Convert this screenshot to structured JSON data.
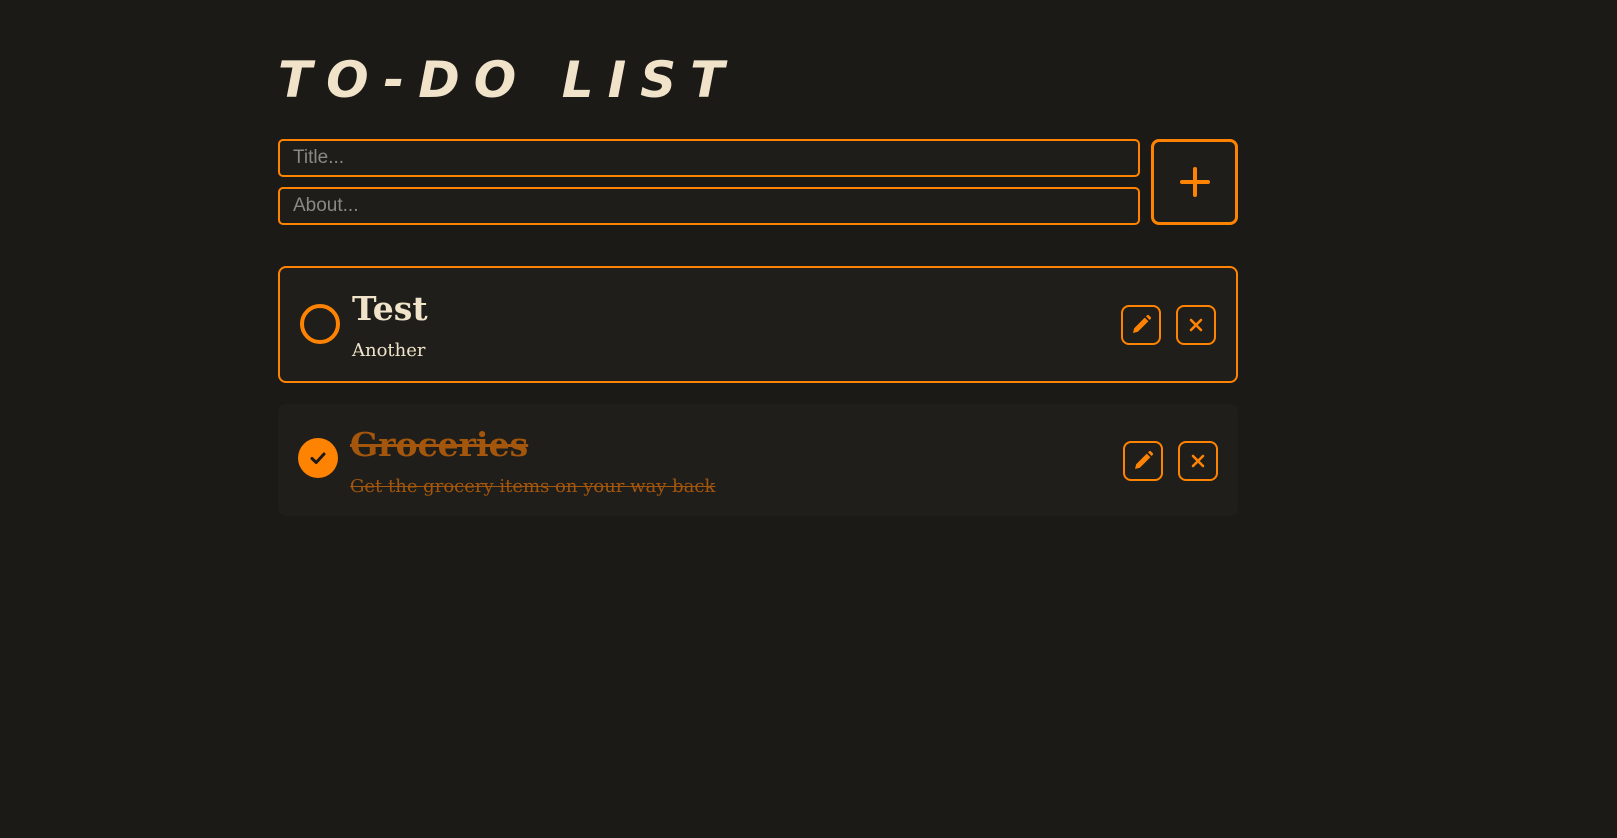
{
  "app": {
    "title": "TO-DO LIST"
  },
  "form": {
    "title_placeholder": "Title...",
    "about_placeholder": "About...",
    "title_value": "",
    "about_value": "",
    "add_icon": "plus-icon"
  },
  "tasks": [
    {
      "title": "Test",
      "about": "Another",
      "completed": false,
      "check_icon": "empty-circle-icon",
      "edit_icon": "pencil-icon",
      "delete_icon": "close-icon"
    },
    {
      "title": "Groceries",
      "about": "Get the grocery items on your way back",
      "completed": true,
      "check_icon": "checkmark-icon",
      "edit_icon": "pencil-icon",
      "delete_icon": "close-icon"
    }
  ],
  "colors": {
    "background": "#1b1a17",
    "accent": "#ff8303",
    "text": "#f0e3ca",
    "completed_text": "#a3560c"
  }
}
